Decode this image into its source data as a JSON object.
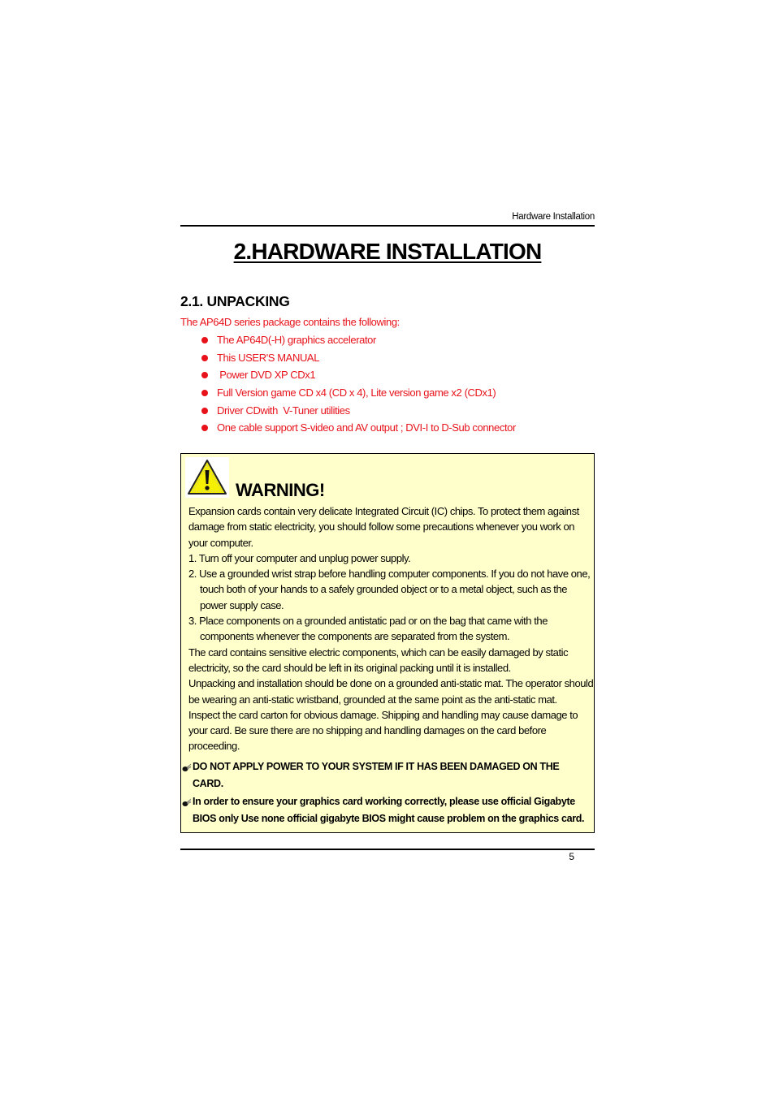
{
  "header": {
    "running_title": "Hardware Installation"
  },
  "chapter": {
    "title": "2.HARDWARE INSTALLATION"
  },
  "section": {
    "title": "2.1. UNPACKING",
    "intro": "The AP64D series package contains the following:",
    "items": [
      {
        "text": "The AP64D(-H) graphics accelerator"
      },
      {
        "text": "This USER'S MANUAL"
      },
      {
        "text": " Power DVD XP CDx1"
      },
      {
        "text": "Full Version game CD x4 (CD x 4), Lite version game x2 (CDx1)"
      },
      {
        "text": "Driver CDwith  V-Tuner utilities"
      },
      {
        "text": "One cable support S-video and AV output ; DVI-I to D-Sub connector"
      }
    ],
    "bullet_color": "#e8121b"
  },
  "warning": {
    "icon": "warning-triangle-icon",
    "title": "WARNING!",
    "paragraphs": [
      "Expansion cards contain very delicate Integrated Circuit (IC) chips. To protect them against damage from static electricity, you should follow some precautions whenever you work on your computer.",
      "1. Turn off your computer and unplug power supply.",
      "2. Use a grounded wrist strap before handling computer components. If you do not have one, touch both of your hands to a safely grounded object or to a metal object, such as the power supply case.",
      "3. Place components on a grounded antistatic pad or on the bag that came with the components whenever the components are separated from the system.",
      "The card contains sensitive electric components, which can be easily damaged by static electricity, so the card should be left in its original packing until it is installed.",
      "Unpacking and installation should be done on a grounded anti-static mat. The operator should be wearing an anti-static wristband, grounded at the same point as the anti-static mat.",
      "Inspect the card carton for obvious damage. Shipping and handling may cause damage to your card. Be sure there are no shipping and handling damages on the card before proceeding."
    ],
    "notes": [
      {
        "icon": "pointing-hand-icon",
        "text": "DO NOT APPLY POWER TO YOUR SYSTEM IF IT HAS BEEN DAMAGED ON THE CARD."
      },
      {
        "icon": "pointing-hand-icon",
        "text": "In order to ensure your graphics card working correctly, please use official Gigabyte BIOS only Use none official gigabyte BIOS might cause problem on the graphics card."
      }
    ],
    "background_color": "#ffffcc"
  },
  "footer": {
    "page_number": "5"
  }
}
